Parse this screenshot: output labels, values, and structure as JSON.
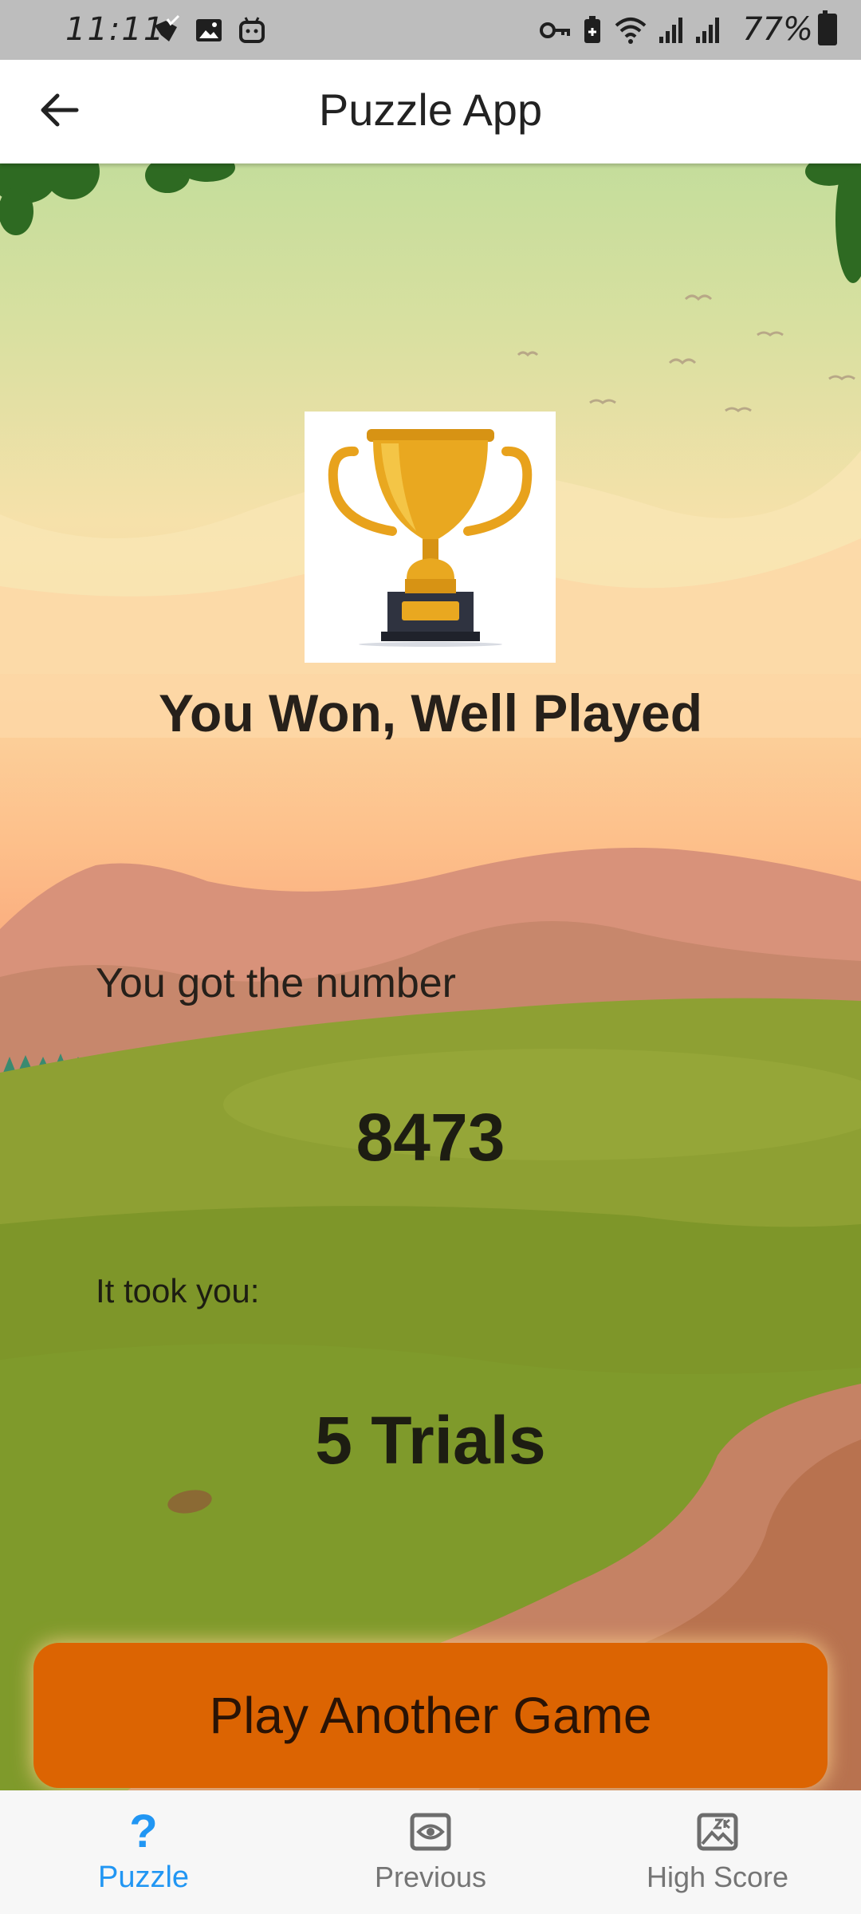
{
  "status_bar": {
    "time": "11:11",
    "battery": "77%",
    "left_icons": [
      "notification-check-icon",
      "gallery-icon",
      "bot-icon"
    ],
    "right_icons": [
      "vpn-key-icon",
      "battery-saver-icon",
      "wifi-icon",
      "signal-icon",
      "signal-icon"
    ]
  },
  "app_bar": {
    "title": "Puzzle App",
    "back_icon": "arrow-left-icon"
  },
  "result": {
    "title": "You Won, Well Played",
    "number_label": "You got the number",
    "number_value": "8473",
    "trials_label": "It took you:",
    "trials_value": "5 Trials",
    "trophy_icon": "trophy-icon"
  },
  "actions": {
    "play_again_label": "Play Another Game"
  },
  "bottom_nav": {
    "active": "Puzzle",
    "items": [
      {
        "label": "Puzzle",
        "icon": "question-mark-icon"
      },
      {
        "label": "Previous",
        "icon": "eye-icon"
      },
      {
        "label": "High Score",
        "icon": "image-icon"
      }
    ]
  },
  "colors": {
    "accent": "#2196f3",
    "button": "#dc6402",
    "status_bar": "#bdbdbd"
  }
}
